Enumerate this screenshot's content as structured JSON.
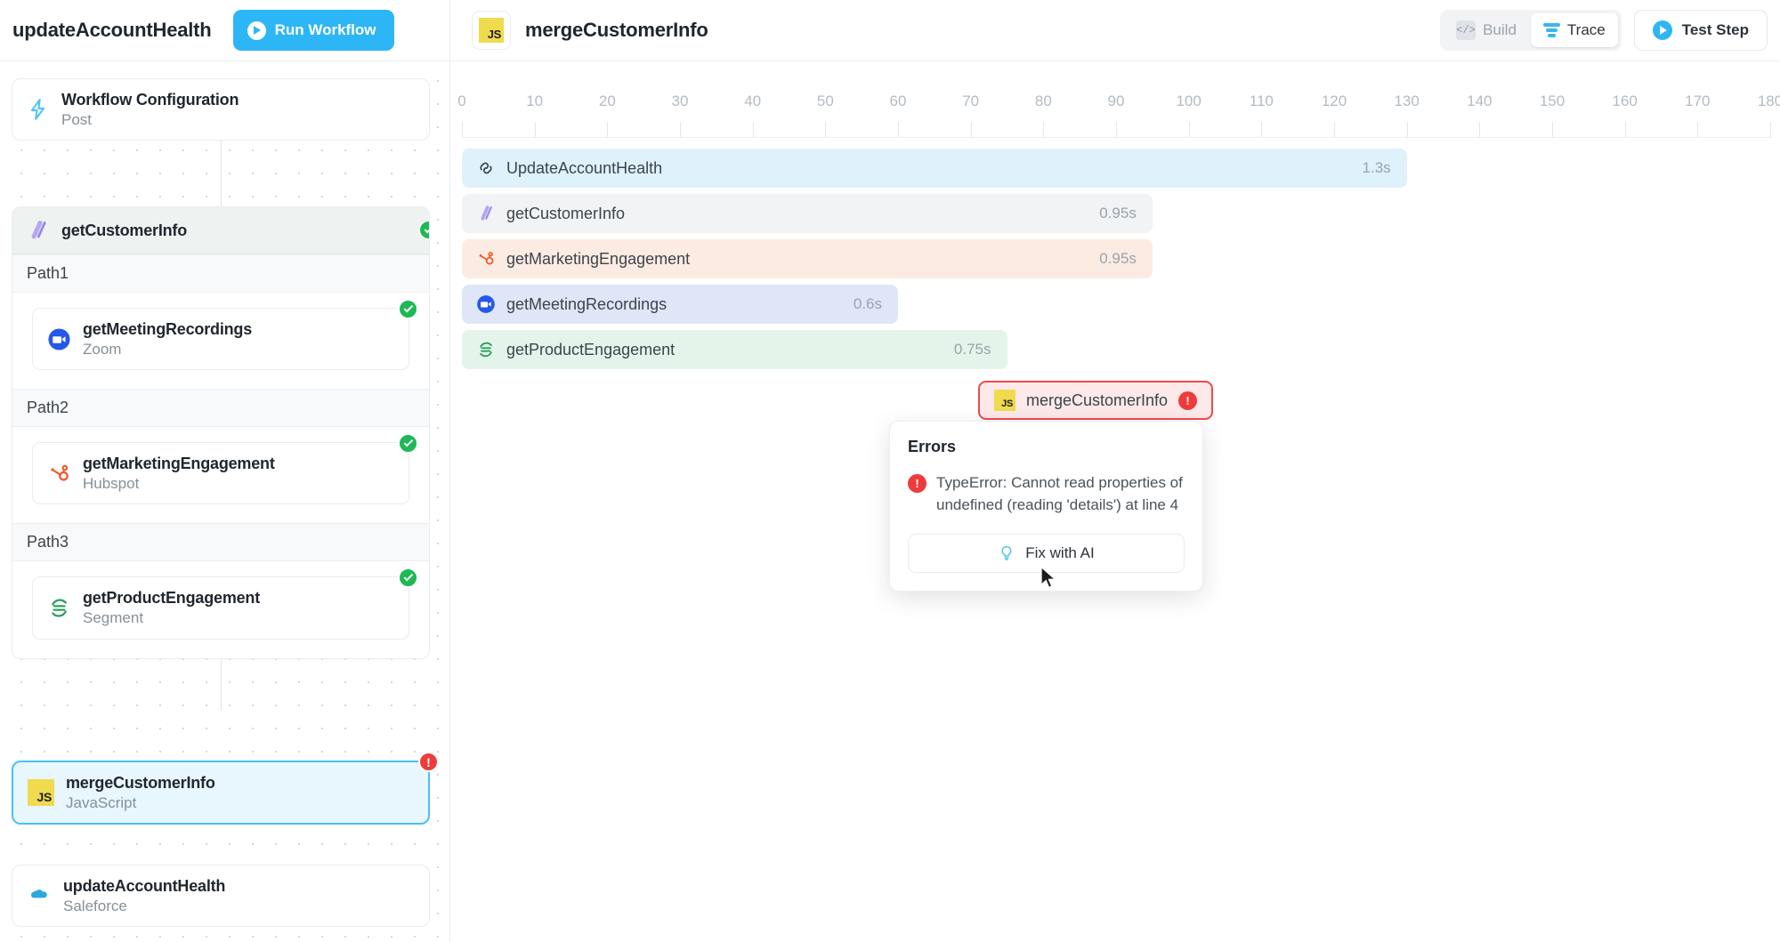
{
  "header": {
    "workflow_title": "updateAccountHealth",
    "run_button": "Run Workflow",
    "run_icon": "play-circle-icon",
    "step_badge": "JS",
    "step_title": "mergeCustomerInfo",
    "view_toggle": [
      {
        "label": "Build",
        "icon": "code-brackets-icon",
        "active": false
      },
      {
        "label": "Trace",
        "icon": "trace-bars-icon",
        "active": true
      }
    ],
    "test_button": "Test Step",
    "test_icon": "play-circle-icon"
  },
  "sidebar": {
    "nodes": [
      {
        "title": "Workflow Configuration",
        "subtitle": "Post",
        "icon": "lightning-bolt-icon",
        "status": ""
      },
      {
        "title": "getCustomerInfo",
        "subtitle": "",
        "icon": "paths-slash-icon",
        "status": "ok"
      },
      {
        "title": "mergeCustomerInfo",
        "subtitle": "JavaScript",
        "icon": "js-badge-icon",
        "status": "error"
      },
      {
        "title": "updateAccountHealth",
        "subtitle": "Saleforce",
        "icon": "salesforce-cloud-icon",
        "status": ""
      }
    ],
    "paths": [
      {
        "label": "Path1",
        "node": {
          "title": "getMeetingRecordings",
          "subtitle": "Zoom",
          "icon": "zoom-camera-icon",
          "status": "ok"
        }
      },
      {
        "label": "Path2",
        "node": {
          "title": "getMarketingEngagement",
          "subtitle": "Hubspot",
          "icon": "hubspot-sprocket-icon",
          "status": "ok"
        }
      },
      {
        "label": "Path3",
        "node": {
          "title": "getProductEngagement",
          "subtitle": "Segment",
          "icon": "segment-icon",
          "status": "ok"
        }
      }
    ]
  },
  "trace": {
    "ruler": {
      "ticks": [
        0,
        10,
        20,
        30,
        40,
        50,
        60,
        70,
        80,
        90,
        100,
        110,
        120,
        130,
        140,
        150,
        160,
        170,
        180
      ],
      "min": 0,
      "max": 180
    },
    "bars": [
      {
        "label": "UpdateAccountHealth",
        "duration": "1.3s",
        "icon": "workflow-link-icon",
        "bg": "#dff1fb",
        "start": 0,
        "end": 130
      },
      {
        "label": "getCustomerInfo",
        "duration": "0.95s",
        "icon": "paths-slash-icon",
        "bg": "#f1f3f5",
        "start": 0,
        "end": 95
      },
      {
        "label": "getMarketingEngagement",
        "duration": "0.95s",
        "icon": "hubspot-sprocket-icon",
        "bg": "#fcebe3",
        "start": 0,
        "end": 95
      },
      {
        "label": "getMeetingRecordings",
        "duration": "0.6s",
        "icon": "zoom-camera-icon",
        "bg": "#dfe6f8",
        "start": 0,
        "end": 60
      },
      {
        "label": "getProductEngagement",
        "duration": "0.75s",
        "icon": "segment-icon",
        "bg": "#e5f4ea",
        "start": 0,
        "end": 75
      }
    ],
    "error_node": {
      "badge": "JS",
      "label": "mergeCustomerInfo",
      "status_icon": "error-exclamation-icon"
    },
    "error_popup": {
      "title": "Errors",
      "icon": "error-exclamation-icon",
      "message": "TypeError: Cannot read properties of undefined (reading 'details') at line 4",
      "fix_button": "Fix with AI",
      "fix_icon": "lightbulb-icon"
    }
  },
  "colors": {
    "accent": "#2db6f5",
    "success": "#1eb854",
    "error": "#ef3b3b",
    "js_yellow": "#f0db4f"
  }
}
